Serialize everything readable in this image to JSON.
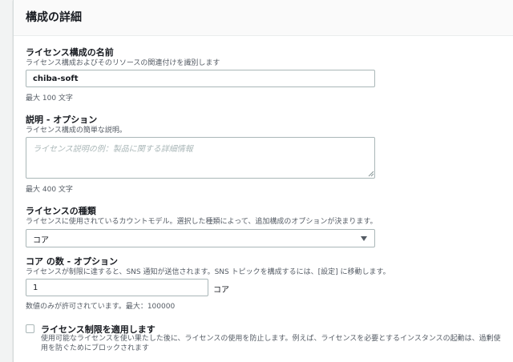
{
  "section": {
    "title": "構成の詳細"
  },
  "name_field": {
    "label": "ライセンス構成の名前",
    "description": "ライセンス構成およびそのリソースの関連付けを識別します",
    "value": "chiba-soft",
    "constraint": "最大 100 文字"
  },
  "description_field": {
    "label": "説明 - オプション",
    "description": "ライセンス構成の簡単な説明。",
    "placeholder": "ライセンス説明の例：製品に関する詳細情報",
    "constraint": "最大 400 文字"
  },
  "license_type": {
    "label": "ライセンスの種類",
    "description": "ライセンスに使用されているカウントモデル。選択した種類によって、追加構成のオプションが決まります。",
    "selected": "コア"
  },
  "core_count": {
    "label": "コア の数 - オプション",
    "description": "ライセンスが制限に達すると、SNS 通知が送信されます。SNS トピックを構成するには、[設定] に移動します。",
    "value": "1",
    "unit": "コア",
    "constraint": "数値のみが許可されています。最大：100000"
  },
  "enforce_limit": {
    "label": "ライセンス制限を適用します",
    "description": "使用可能なライセンスを使い果たした後に、ライセンスの使用を防止します。例えば、ライセンスを必要とするインスタンスの起動は、過剰使用を防ぐためにブロックされます",
    "checked": false
  }
}
